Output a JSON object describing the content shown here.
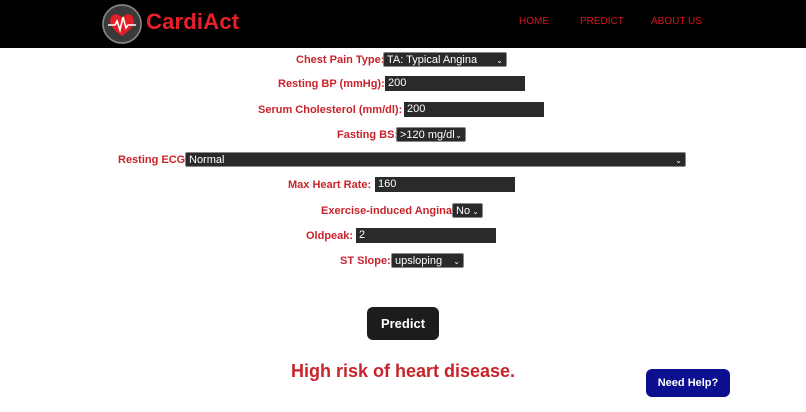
{
  "brand": {
    "name": "CardiAct",
    "logo_icon": "heart-pulse-icon"
  },
  "nav": {
    "home": "HOME",
    "predict": "PREDICT",
    "about": "ABOUT US"
  },
  "form": {
    "chest_pain_type": {
      "label": "Chest Pain Type:",
      "value": "TA: Typical Angina"
    },
    "resting_bp": {
      "label": "Resting BP (mmHg):",
      "value": "200"
    },
    "serum_cholesterol": {
      "label": "Serum Cholesterol (mm/dl):",
      "value": "200"
    },
    "fasting_bs": {
      "label": "Fasting BS:",
      "value": ">120 mg/dl"
    },
    "resting_ecg": {
      "label": "Resting ECG:",
      "value": "Normal"
    },
    "max_heart_rate": {
      "label": "Max Heart Rate:",
      "value": "160"
    },
    "exercise_angina": {
      "label": "Exercise-induced Angina:",
      "value": "No"
    },
    "oldpeak": {
      "label": "Oldpeak:",
      "value": "2"
    },
    "st_slope": {
      "label": "ST Slope:",
      "value": "upsloping"
    }
  },
  "predict_button": "Predict",
  "result_text": "High risk of heart disease.",
  "help_button": "Need Help?",
  "colors": {
    "accent_red": "#c8232b",
    "nav_bg": "#000000",
    "help_bg": "#0c0f8f"
  }
}
